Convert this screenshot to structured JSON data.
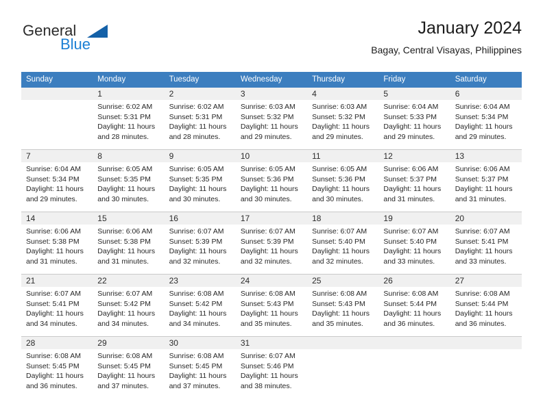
{
  "brand": {
    "name_part1": "General",
    "name_part2": "Blue",
    "accent_color": "#1b7fd4",
    "triangle_color": "#1461a8"
  },
  "header": {
    "title": "January 2024",
    "subtitle": "Bagay, Central Visayas, Philippines"
  },
  "calendar": {
    "header_background": "#3c7ebf",
    "daynum_background": "#f0f0f0",
    "weekdays": [
      "Sunday",
      "Monday",
      "Tuesday",
      "Wednesday",
      "Thursday",
      "Friday",
      "Saturday"
    ],
    "weeks": [
      [
        {
          "day": "",
          "lines": []
        },
        {
          "day": "1",
          "lines": [
            "Sunrise: 6:02 AM",
            "Sunset: 5:31 PM",
            "Daylight: 11 hours",
            "and 28 minutes."
          ]
        },
        {
          "day": "2",
          "lines": [
            "Sunrise: 6:02 AM",
            "Sunset: 5:31 PM",
            "Daylight: 11 hours",
            "and 28 minutes."
          ]
        },
        {
          "day": "3",
          "lines": [
            "Sunrise: 6:03 AM",
            "Sunset: 5:32 PM",
            "Daylight: 11 hours",
            "and 29 minutes."
          ]
        },
        {
          "day": "4",
          "lines": [
            "Sunrise: 6:03 AM",
            "Sunset: 5:32 PM",
            "Daylight: 11 hours",
            "and 29 minutes."
          ]
        },
        {
          "day": "5",
          "lines": [
            "Sunrise: 6:04 AM",
            "Sunset: 5:33 PM",
            "Daylight: 11 hours",
            "and 29 minutes."
          ]
        },
        {
          "day": "6",
          "lines": [
            "Sunrise: 6:04 AM",
            "Sunset: 5:34 PM",
            "Daylight: 11 hours",
            "and 29 minutes."
          ]
        }
      ],
      [
        {
          "day": "7",
          "lines": [
            "Sunrise: 6:04 AM",
            "Sunset: 5:34 PM",
            "Daylight: 11 hours",
            "and 29 minutes."
          ]
        },
        {
          "day": "8",
          "lines": [
            "Sunrise: 6:05 AM",
            "Sunset: 5:35 PM",
            "Daylight: 11 hours",
            "and 30 minutes."
          ]
        },
        {
          "day": "9",
          "lines": [
            "Sunrise: 6:05 AM",
            "Sunset: 5:35 PM",
            "Daylight: 11 hours",
            "and 30 minutes."
          ]
        },
        {
          "day": "10",
          "lines": [
            "Sunrise: 6:05 AM",
            "Sunset: 5:36 PM",
            "Daylight: 11 hours",
            "and 30 minutes."
          ]
        },
        {
          "day": "11",
          "lines": [
            "Sunrise: 6:05 AM",
            "Sunset: 5:36 PM",
            "Daylight: 11 hours",
            "and 30 minutes."
          ]
        },
        {
          "day": "12",
          "lines": [
            "Sunrise: 6:06 AM",
            "Sunset: 5:37 PM",
            "Daylight: 11 hours",
            "and 31 minutes."
          ]
        },
        {
          "day": "13",
          "lines": [
            "Sunrise: 6:06 AM",
            "Sunset: 5:37 PM",
            "Daylight: 11 hours",
            "and 31 minutes."
          ]
        }
      ],
      [
        {
          "day": "14",
          "lines": [
            "Sunrise: 6:06 AM",
            "Sunset: 5:38 PM",
            "Daylight: 11 hours",
            "and 31 minutes."
          ]
        },
        {
          "day": "15",
          "lines": [
            "Sunrise: 6:06 AM",
            "Sunset: 5:38 PM",
            "Daylight: 11 hours",
            "and 31 minutes."
          ]
        },
        {
          "day": "16",
          "lines": [
            "Sunrise: 6:07 AM",
            "Sunset: 5:39 PM",
            "Daylight: 11 hours",
            "and 32 minutes."
          ]
        },
        {
          "day": "17",
          "lines": [
            "Sunrise: 6:07 AM",
            "Sunset: 5:39 PM",
            "Daylight: 11 hours",
            "and 32 minutes."
          ]
        },
        {
          "day": "18",
          "lines": [
            "Sunrise: 6:07 AM",
            "Sunset: 5:40 PM",
            "Daylight: 11 hours",
            "and 32 minutes."
          ]
        },
        {
          "day": "19",
          "lines": [
            "Sunrise: 6:07 AM",
            "Sunset: 5:40 PM",
            "Daylight: 11 hours",
            "and 33 minutes."
          ]
        },
        {
          "day": "20",
          "lines": [
            "Sunrise: 6:07 AM",
            "Sunset: 5:41 PM",
            "Daylight: 11 hours",
            "and 33 minutes."
          ]
        }
      ],
      [
        {
          "day": "21",
          "lines": [
            "Sunrise: 6:07 AM",
            "Sunset: 5:41 PM",
            "Daylight: 11 hours",
            "and 34 minutes."
          ]
        },
        {
          "day": "22",
          "lines": [
            "Sunrise: 6:07 AM",
            "Sunset: 5:42 PM",
            "Daylight: 11 hours",
            "and 34 minutes."
          ]
        },
        {
          "day": "23",
          "lines": [
            "Sunrise: 6:08 AM",
            "Sunset: 5:42 PM",
            "Daylight: 11 hours",
            "and 34 minutes."
          ]
        },
        {
          "day": "24",
          "lines": [
            "Sunrise: 6:08 AM",
            "Sunset: 5:43 PM",
            "Daylight: 11 hours",
            "and 35 minutes."
          ]
        },
        {
          "day": "25",
          "lines": [
            "Sunrise: 6:08 AM",
            "Sunset: 5:43 PM",
            "Daylight: 11 hours",
            "and 35 minutes."
          ]
        },
        {
          "day": "26",
          "lines": [
            "Sunrise: 6:08 AM",
            "Sunset: 5:44 PM",
            "Daylight: 11 hours",
            "and 36 minutes."
          ]
        },
        {
          "day": "27",
          "lines": [
            "Sunrise: 6:08 AM",
            "Sunset: 5:44 PM",
            "Daylight: 11 hours",
            "and 36 minutes."
          ]
        }
      ],
      [
        {
          "day": "28",
          "lines": [
            "Sunrise: 6:08 AM",
            "Sunset: 5:45 PM",
            "Daylight: 11 hours",
            "and 36 minutes."
          ]
        },
        {
          "day": "29",
          "lines": [
            "Sunrise: 6:08 AM",
            "Sunset: 5:45 PM",
            "Daylight: 11 hours",
            "and 37 minutes."
          ]
        },
        {
          "day": "30",
          "lines": [
            "Sunrise: 6:08 AM",
            "Sunset: 5:45 PM",
            "Daylight: 11 hours",
            "and 37 minutes."
          ]
        },
        {
          "day": "31",
          "lines": [
            "Sunrise: 6:07 AM",
            "Sunset: 5:46 PM",
            "Daylight: 11 hours",
            "and 38 minutes."
          ]
        },
        {
          "day": "",
          "lines": []
        },
        {
          "day": "",
          "lines": []
        },
        {
          "day": "",
          "lines": []
        }
      ]
    ]
  }
}
